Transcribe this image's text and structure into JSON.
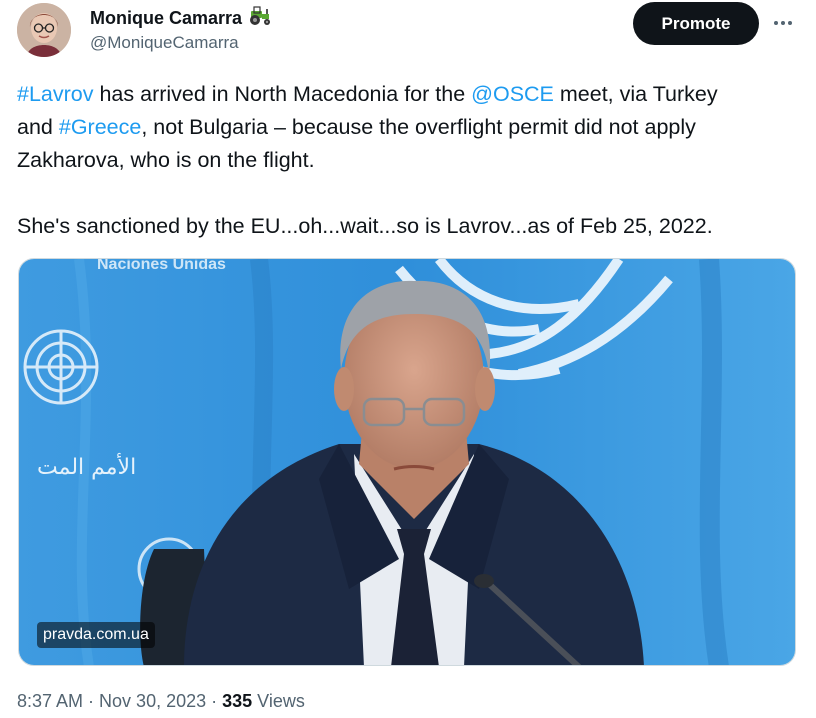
{
  "author": {
    "name": "Monique Camarra",
    "handle": "@MoniqueCamarra",
    "badge_icon": "tractor-emoji-icon"
  },
  "actions": {
    "promote_label": "Promote",
    "more_icon": "more-horizontal-icon"
  },
  "tweet": {
    "line1_part1": "#Lavrov",
    "line1_part2": " has arrived in North Macedonia for the ",
    "line1_part3": "@OSCE",
    "line1_part4": " meet, via Turkey",
    "line2_part1": "and ",
    "line2_part2": "#Greece",
    "line2_part3": ", not Bulgaria – because the overflight permit did not apply",
    "line3": "Zakharova, who is on the flight.",
    "line4": "She's sanctioned by the EU...oh...wait...so is Lavrov...as of Feb 25, 2022."
  },
  "media": {
    "watermark": "pravda.com.ua",
    "backdrop_text": "Naciones Unidas",
    "arabic_text": "الأمم المت"
  },
  "meta": {
    "time": "8:37 AM",
    "separator1": " · ",
    "date": "Nov 30, 2023",
    "separator2": " · ",
    "views_count": "335",
    "views_label": " Views"
  },
  "colors": {
    "link": "#1d9bf0",
    "text": "#0f1419",
    "secondary": "#536471",
    "un_blue": "#3a9be0"
  }
}
